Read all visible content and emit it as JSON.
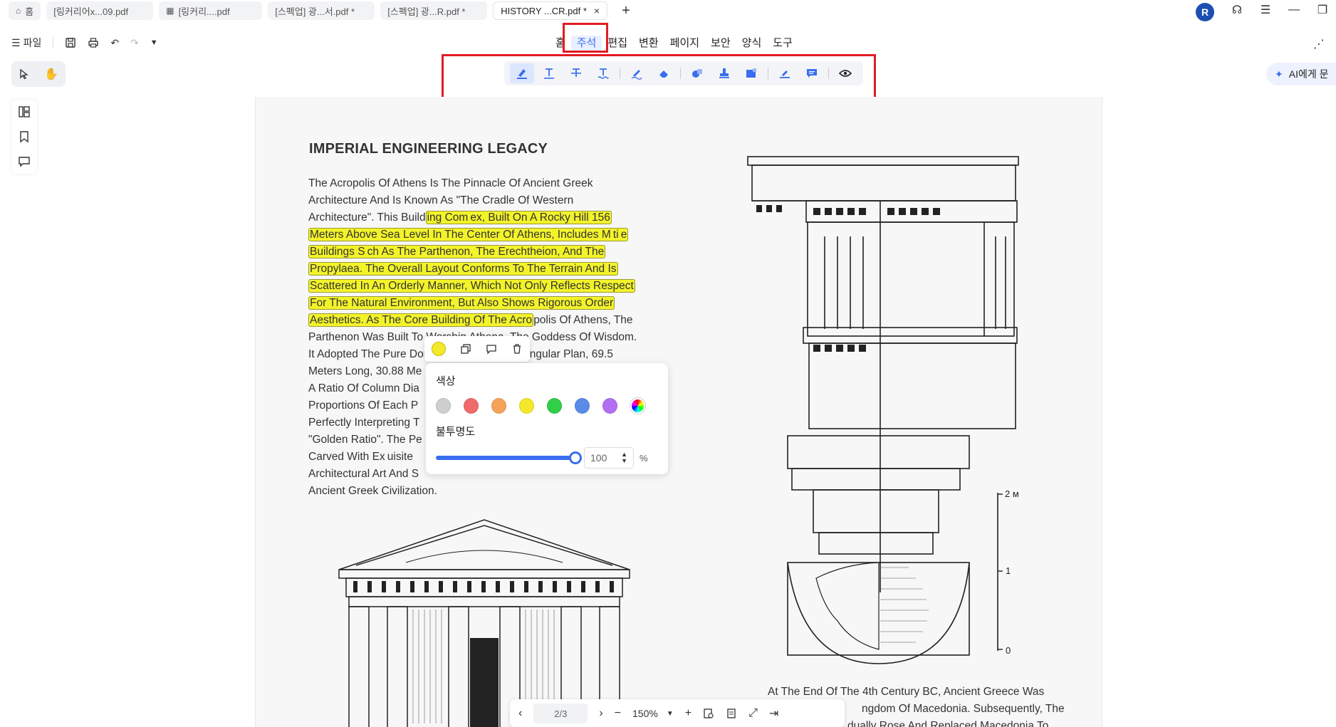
{
  "tabs": [
    {
      "label": "홈",
      "icon": "home-icon"
    },
    {
      "label": "[링커리어x...09.pdf",
      "icon": ""
    },
    {
      "label": "[링커리....pdf",
      "icon": "grid-icon"
    },
    {
      "label": "[스펙업] 광...서.pdf *",
      "icon": ""
    },
    {
      "label": "[스펙업] 광...R.pdf *",
      "icon": ""
    },
    {
      "label": "HISTORY ...CR.pdf *",
      "icon": ""
    }
  ],
  "avatar_letter": "R",
  "file_menu": "파일",
  "main_menu": [
    "홈",
    "주석",
    "편집",
    "변환",
    "페이지",
    "보안",
    "양식",
    "도구"
  ],
  "active_menu": "주석",
  "ai_button": "AI에게 문",
  "doc": {
    "title": "IMPERIAL ENGINEERING LEGACY",
    "lines": [
      {
        "pre": "The Acropolis Of Athens Is The Pinnacle Of Ancient Greek",
        "hl": "",
        "post": ""
      },
      {
        "pre": "Architecture And Is Known As \"The Cradle Of Western",
        "hl": "",
        "post": ""
      },
      {
        "pre": "Architecture\". This Build",
        "hl": "ing Com ex, Built On A Rocky Hill 156",
        "post": ""
      },
      {
        "pre": "",
        "hl": "Meters Above Sea Level In The Center Of Athens, Includes M ti e",
        "post": ""
      },
      {
        "pre": "",
        "hl": "Buildings S ch As The Parthenon, The Erechtheion, And The",
        "post": ""
      },
      {
        "pre": "",
        "hl": "Propylaea. The Overall Layout Conforms To The Terrain And Is",
        "post": ""
      },
      {
        "pre": "",
        "hl": "Scattered In An Orderly Manner, Which Not Only Reflects Respect",
        "post": ""
      },
      {
        "pre": "",
        "hl": "For The Natural Environment, But Also Shows Rigorous Order",
        "post": ""
      },
      {
        "pre": "",
        "hl": "Aesthetics. As The Core Building Of The Acro",
        "post": "polis Of Athens, The"
      },
      {
        "pre": "Parthenon Was Built To Worship Athena, The Goddess Of Wisdom.",
        "hl": "",
        "post": ""
      },
      {
        "pre": "It Adopted The Pure Doric Order And A Rectangular Plan, 69.5",
        "hl": "",
        "post": ""
      },
      {
        "pre": "Meters Long, 30.88 Me",
        "hl": "",
        "post": ""
      },
      {
        "pre": "A Ratio Of Column Dia",
        "hl": "",
        "post": ""
      },
      {
        "pre": "Proportions Of Each P",
        "hl": "",
        "post": ""
      },
      {
        "pre": "Perfectly Interpreting T",
        "hl": "",
        "post": ""
      },
      {
        "pre": "\"Golden Ratio\". The Pe",
        "hl": "",
        "post": ""
      },
      {
        "pre": "Carved With Ex uisite",
        "hl": "",
        "post": ""
      },
      {
        "pre": "Architectural Art And S",
        "hl": "",
        "post": ""
      },
      {
        "pre": "Ancient Greek Civilization.",
        "hl": "",
        "post": ""
      }
    ],
    "right_lines": [
      "At The End Of The 4th Century BC, Ancient Greece Was",
      "ngdom Of Macedonia. Subsequently, The",
      "dually Rose And Replaced Macedonia To"
    ],
    "scale_labels": [
      "2 м",
      "1",
      "0"
    ]
  },
  "popup": {
    "color_label": "색상",
    "opacity_label": "불투명도",
    "opacity_value": "100",
    "opacity_unit": "%",
    "opacity_fraction": 1.0,
    "colors": [
      "#cfcfcf",
      "#ef6b6b",
      "#f6a35a",
      "#f3e82a",
      "#2fcf4a",
      "#5b8be8",
      "#b36ef2",
      "rainbow"
    ],
    "selected_color": "#f3e82a"
  },
  "bottom": {
    "page": "2/3",
    "zoom": "150%"
  },
  "colors": {
    "accent": "#3a6df0",
    "highlight_red_box": "#e31b23",
    "highlight_yellow": "#f3f32a"
  }
}
